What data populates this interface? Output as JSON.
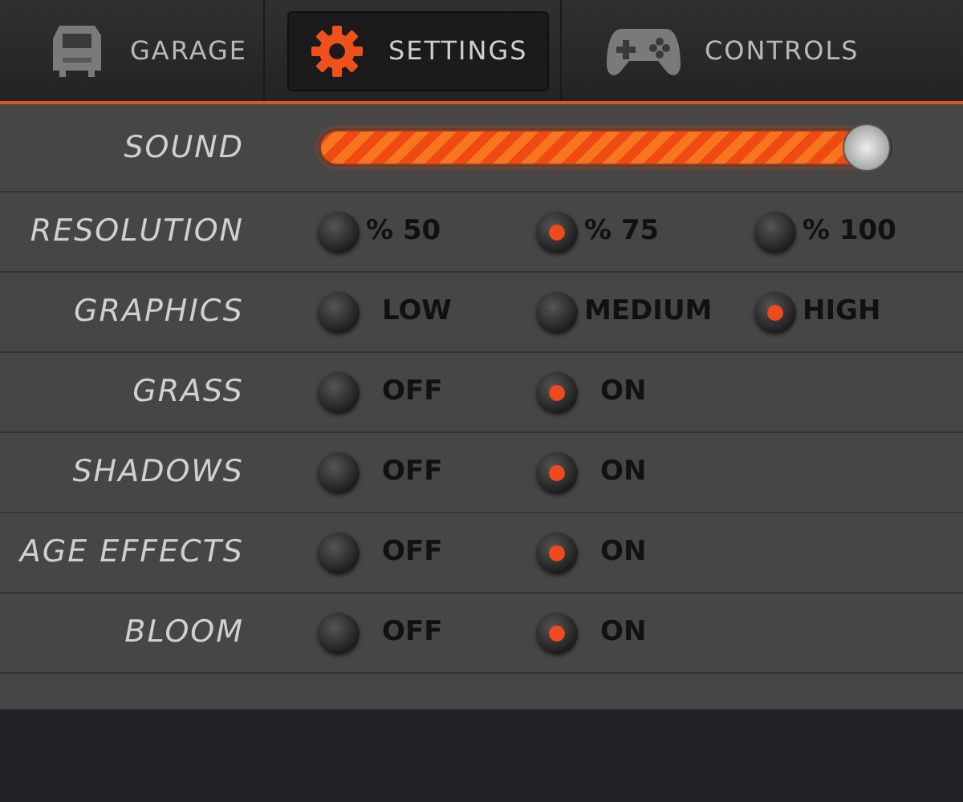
{
  "tabs": [
    {
      "label": "GARAGE",
      "kind": "truck",
      "selected": false
    },
    {
      "label": "SETTINGS",
      "kind": "gear",
      "selected": true
    },
    {
      "label": "CONTROLS",
      "kind": "gamepad",
      "selected": false
    }
  ],
  "settings": [
    {
      "kind": "slider",
      "label": "SOUND",
      "level": 0.96
    },
    {
      "kind": "radio",
      "label": "RESOLUTION",
      "options": [
        {
          "label": "% 50",
          "selected": false
        },
        {
          "label": "% 75",
          "selected": true
        },
        {
          "label": "% 100",
          "selected": false
        }
      ]
    },
    {
      "kind": "radio",
      "label": "GRAPHICS",
      "options": [
        {
          "label": "LOW",
          "selected": false
        },
        {
          "label": "MEDIUM",
          "selected": false
        },
        {
          "label": "HIGH",
          "selected": true
        }
      ]
    },
    {
      "kind": "radio",
      "label": "GRASS",
      "options": [
        {
          "label": "OFF",
          "selected": false
        },
        {
          "label": "ON",
          "selected": true
        }
      ]
    },
    {
      "kind": "radio",
      "label": "SHADOWS",
      "options": [
        {
          "label": "OFF",
          "selected": false
        },
        {
          "label": "ON",
          "selected": true
        }
      ]
    },
    {
      "kind": "radio",
      "label": "AGE EFFECTS",
      "options": [
        {
          "label": "OFF",
          "selected": false
        },
        {
          "label": "ON",
          "selected": true
        }
      ]
    },
    {
      "kind": "radio",
      "label": "BLOOM",
      "options": [
        {
          "label": "OFF",
          "selected": false
        },
        {
          "label": "ON",
          "selected": true
        }
      ]
    }
  ]
}
